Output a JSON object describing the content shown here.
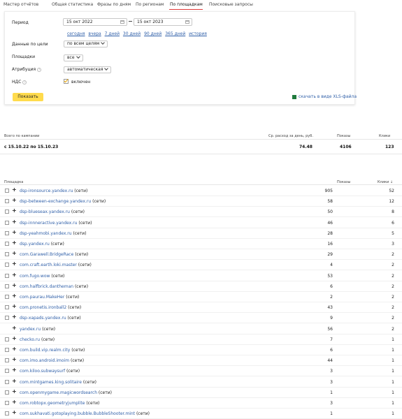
{
  "tabs": [
    {
      "label": "Мастер отчётов"
    },
    {
      "label": "Общая статистика"
    },
    {
      "label": "Фразы по дням"
    },
    {
      "label": "По регионам"
    },
    {
      "label": "По площадкам"
    },
    {
      "label": "Поисковые запросы"
    }
  ],
  "filters": {
    "period_label": "Период",
    "date_from": "15 окт 2022",
    "date_to": "15 окт 2023",
    "quick_links": [
      "сегодня",
      "вчера",
      "7 дней",
      "30 дней",
      "90 дней",
      "365 дней",
      "история"
    ],
    "goal_label": "Данные по цели",
    "goal_value": "по всем целям",
    "sites_label": "Площадки",
    "sites_value": "все",
    "attribution_label": "Атрибуция",
    "attribution_value": "автоматическая",
    "vat_label": "НДС",
    "vat_value": "включен",
    "show_button": "Показать",
    "xls_link": "скачать в виде XLS-файла"
  },
  "summary": {
    "headers": {
      "campaign": "Всего по кампании",
      "spend": "Ср. расход за день, руб.",
      "shows": "Показы",
      "clicks": "Клики"
    },
    "row": {
      "period": "с 15.10.22 по 15.10.23",
      "spend": "74.48",
      "shows": "4106",
      "clicks": "123"
    }
  },
  "sites": {
    "headers": {
      "site": "Площадка",
      "shows": "Показы",
      "clicks": "Клики ↓"
    },
    "rows": [
      {
        "name": "dsp-ironsource.yandex.ru",
        "net": " (сети)",
        "shows": "905",
        "clicks": "52",
        "has_check": true
      },
      {
        "name": "dsp-between-exchange.yandex.ru",
        "net": " (сети)",
        "shows": "58",
        "clicks": "12",
        "has_check": true
      },
      {
        "name": "dsp-blueseax.yandex.ru",
        "net": " (сети)",
        "shows": "50",
        "clicks": "8",
        "has_check": true
      },
      {
        "name": "dsp-innneractive.yandex.ru",
        "net": " (сети)",
        "shows": "46",
        "clicks": "6",
        "has_check": true
      },
      {
        "name": "dsp-yeahmobi.yandex.ru",
        "net": " (сети)",
        "shows": "28",
        "clicks": "5",
        "has_check": true
      },
      {
        "name": "dsp.yandex.ru",
        "net": " (сети)",
        "shows": "16",
        "clicks": "3",
        "has_check": true
      },
      {
        "name": "com.Garawell.BridgeRace",
        "net": " (сети)",
        "shows": "29",
        "clicks": "2",
        "has_check": true
      },
      {
        "name": "com.craft.earth.loki.master",
        "net": " (сети)",
        "shows": "4",
        "clicks": "2",
        "has_check": true
      },
      {
        "name": "com.fugo.wow",
        "net": " (сети)",
        "shows": "53",
        "clicks": "2",
        "has_check": true
      },
      {
        "name": "com.halfbrick.dantheman",
        "net": " (сети)",
        "shows": "6",
        "clicks": "2",
        "has_check": true
      },
      {
        "name": "com.paurau.MakeHer",
        "net": " (сети)",
        "shows": "2",
        "clicks": "2",
        "has_check": true
      },
      {
        "name": "com.pronetis.ironball2",
        "net": " (сети)",
        "shows": "43",
        "clicks": "2",
        "has_check": true
      },
      {
        "name": "dsp-xapads.yandex.ru",
        "net": " (сети)",
        "shows": "9",
        "clicks": "2",
        "has_check": true
      },
      {
        "name": "yandex.ru",
        "net": " (сети)",
        "shows": "56",
        "clicks": "2",
        "has_check": false
      },
      {
        "name": "checko.ru",
        "net": " (сети)",
        "shows": "7",
        "clicks": "1",
        "has_check": true
      },
      {
        "name": "com.build.vip.realm.city",
        "net": " (сети)",
        "shows": "6",
        "clicks": "1",
        "has_check": true
      },
      {
        "name": "com.imo.android.imoim",
        "net": " (сети)",
        "shows": "44",
        "clicks": "1",
        "has_check": true
      },
      {
        "name": "com.kiloo.subwaysurf",
        "net": " (сети)",
        "shows": "3",
        "clicks": "1",
        "has_check": true
      },
      {
        "name": "com.mintgames.king.solitaire",
        "net": " (сети)",
        "shows": "3",
        "clicks": "1",
        "has_check": true
      },
      {
        "name": "com.openmygame.magicwordsearch",
        "net": " (сети)",
        "shows": "1",
        "clicks": "1",
        "has_check": true
      },
      {
        "name": "com.robtopx.geometryjumplite",
        "net": " (сети)",
        "shows": "3",
        "clicks": "1",
        "has_check": true
      },
      {
        "name": "com.sukhavati.gotoplaying.bubble.BubbleShooter.mint",
        "net": " (сети)",
        "shows": "1",
        "clicks": "1",
        "has_check": true
      }
    ]
  },
  "colors": {
    "accent_yellow": "#ffdb4d",
    "link_blue": "#2f5fa8",
    "tab_active_underline": "#e03b3b",
    "check_orange": "#e8a300"
  }
}
